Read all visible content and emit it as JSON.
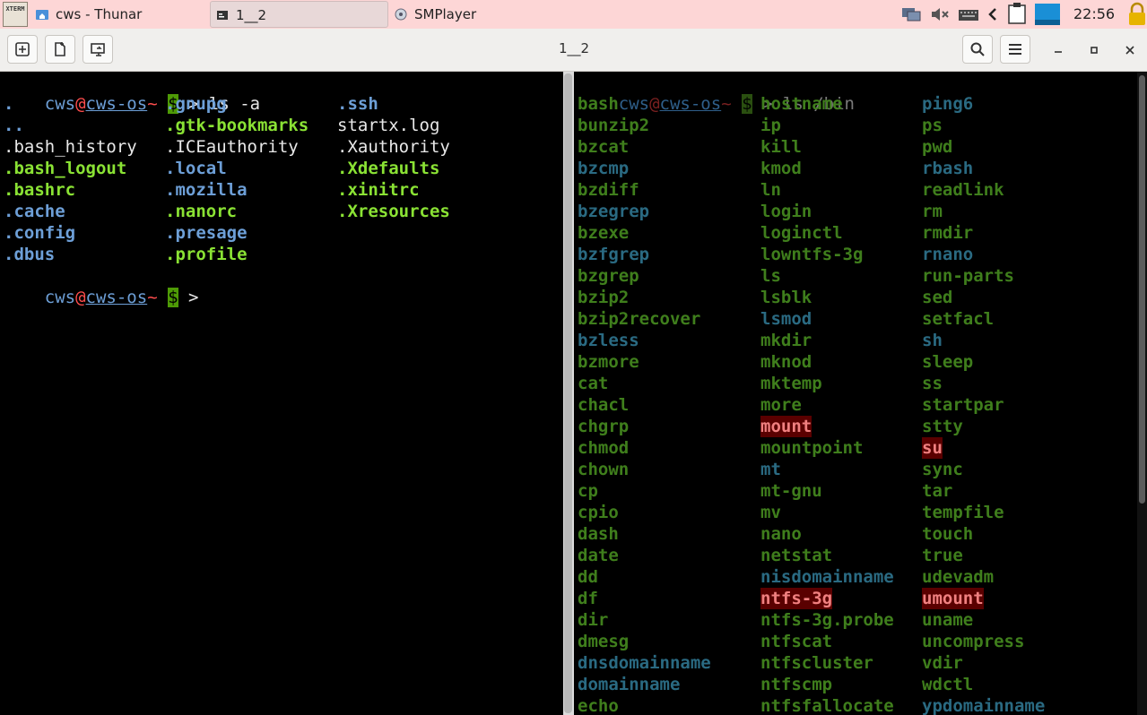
{
  "taskbar": {
    "menu_label": "XTERM",
    "tasks": [
      {
        "label": "cws - Thunar",
        "icon": "folder-home-icon"
      },
      {
        "label": "1__2",
        "icon": "terminal-icon"
      },
      {
        "label": "SMPlayer",
        "icon": "smplayer-icon"
      }
    ],
    "tray": [
      "network-icon",
      "volume-muted-icon",
      "keyboard-icon",
      "chevron-left-icon",
      "clipboard-icon",
      "workspace-icon",
      "lock-icon"
    ],
    "clock": "22:56"
  },
  "window": {
    "title": "1__2",
    "buttons": [
      "new-tab-icon",
      "split-icon",
      "detach-icon"
    ],
    "controls": [
      "search-icon",
      "menu-icon",
      "minimize-icon",
      "maximize-icon",
      "close-icon"
    ]
  },
  "left_terminal": {
    "prompt": {
      "user": "cws",
      "at": "@",
      "host": "cws-os",
      "tilde": "~",
      "dollar": "$",
      "arrow": " > "
    },
    "command": "ls -a",
    "columns": [
      [
        {
          "text": ".",
          "kind": "dir"
        },
        {
          "text": "..",
          "kind": "dir"
        },
        {
          "text": ".bash_history",
          "kind": "plain"
        },
        {
          "text": ".bash_logout",
          "kind": "exec"
        },
        {
          "text": ".bashrc",
          "kind": "exec"
        },
        {
          "text": ".cache",
          "kind": "dir"
        },
        {
          "text": ".config",
          "kind": "dir"
        },
        {
          "text": ".dbus",
          "kind": "dir"
        }
      ],
      [
        {
          "text": ".gnupg",
          "kind": "dir"
        },
        {
          "text": ".gtk-bookmarks",
          "kind": "exec"
        },
        {
          "text": ".ICEauthority",
          "kind": "plain"
        },
        {
          "text": ".local",
          "kind": "dir"
        },
        {
          "text": ".mozilla",
          "kind": "dir"
        },
        {
          "text": ".nanorc",
          "kind": "exec"
        },
        {
          "text": ".presage",
          "kind": "dir"
        },
        {
          "text": ".profile",
          "kind": "exec"
        }
      ],
      [
        {
          "text": ".ssh",
          "kind": "dir"
        },
        {
          "text": "startx.log",
          "kind": "plain"
        },
        {
          "text": ".Xauthority",
          "kind": "plain"
        },
        {
          "text": ".Xdefaults",
          "kind": "exec"
        },
        {
          "text": ".xinitrc",
          "kind": "exec"
        },
        {
          "text": ".Xresources",
          "kind": "exec"
        }
      ]
    ]
  },
  "right_terminal": {
    "prompt": {
      "user": "cws",
      "at": "@",
      "host": "cws-os",
      "tilde": "~",
      "dollar": "$",
      "arrow": " > "
    },
    "command": "ls /bin",
    "columns": [
      [
        {
          "text": "bash",
          "kind": "g"
        },
        {
          "text": "bunzip2",
          "kind": "g"
        },
        {
          "text": "bzcat",
          "kind": "g"
        },
        {
          "text": "bzcmp",
          "kind": "t"
        },
        {
          "text": "bzdiff",
          "kind": "g"
        },
        {
          "text": "bzegrep",
          "kind": "t"
        },
        {
          "text": "bzexe",
          "kind": "g"
        },
        {
          "text": "bzfgrep",
          "kind": "t"
        },
        {
          "text": "bzgrep",
          "kind": "g"
        },
        {
          "text": "bzip2",
          "kind": "g"
        },
        {
          "text": "bzip2recover",
          "kind": "g"
        },
        {
          "text": "bzless",
          "kind": "t"
        },
        {
          "text": "bzmore",
          "kind": "g"
        },
        {
          "text": "cat",
          "kind": "g"
        },
        {
          "text": "chacl",
          "kind": "g"
        },
        {
          "text": "chgrp",
          "kind": "g"
        },
        {
          "text": "chmod",
          "kind": "g"
        },
        {
          "text": "chown",
          "kind": "g"
        },
        {
          "text": "cp",
          "kind": "g"
        },
        {
          "text": "cpio",
          "kind": "g"
        },
        {
          "text": "dash",
          "kind": "g"
        },
        {
          "text": "date",
          "kind": "g"
        },
        {
          "text": "dd",
          "kind": "g"
        },
        {
          "text": "df",
          "kind": "g"
        },
        {
          "text": "dir",
          "kind": "g"
        },
        {
          "text": "dmesg",
          "kind": "g"
        },
        {
          "text": "dnsdomainname",
          "kind": "t"
        },
        {
          "text": "domainname",
          "kind": "t"
        },
        {
          "text": "echo",
          "kind": "g"
        }
      ],
      [
        {
          "text": "hostname",
          "kind": "g"
        },
        {
          "text": "ip",
          "kind": "g"
        },
        {
          "text": "kill",
          "kind": "g"
        },
        {
          "text": "kmod",
          "kind": "g"
        },
        {
          "text": "ln",
          "kind": "g"
        },
        {
          "text": "login",
          "kind": "g"
        },
        {
          "text": "loginctl",
          "kind": "g"
        },
        {
          "text": "lowntfs-3g",
          "kind": "g"
        },
        {
          "text": "ls",
          "kind": "g"
        },
        {
          "text": "lsblk",
          "kind": "g"
        },
        {
          "text": "lsmod",
          "kind": "t"
        },
        {
          "text": "mkdir",
          "kind": "g"
        },
        {
          "text": "mknod",
          "kind": "g"
        },
        {
          "text": "mktemp",
          "kind": "g"
        },
        {
          "text": "more",
          "kind": "g"
        },
        {
          "text": "mount",
          "kind": "red"
        },
        {
          "text": "mountpoint",
          "kind": "g"
        },
        {
          "text": "mt",
          "kind": "t"
        },
        {
          "text": "mt-gnu",
          "kind": "g"
        },
        {
          "text": "mv",
          "kind": "g"
        },
        {
          "text": "nano",
          "kind": "g"
        },
        {
          "text": "netstat",
          "kind": "g"
        },
        {
          "text": "nisdomainname",
          "kind": "t"
        },
        {
          "text": "ntfs-3g",
          "kind": "red"
        },
        {
          "text": "ntfs-3g.probe",
          "kind": "g"
        },
        {
          "text": "ntfscat",
          "kind": "g"
        },
        {
          "text": "ntfscluster",
          "kind": "g"
        },
        {
          "text": "ntfscmp",
          "kind": "g"
        },
        {
          "text": "ntfsfallocate",
          "kind": "g"
        }
      ],
      [
        {
          "text": "ping6",
          "kind": "t"
        },
        {
          "text": "ps",
          "kind": "g"
        },
        {
          "text": "pwd",
          "kind": "g"
        },
        {
          "text": "rbash",
          "kind": "t"
        },
        {
          "text": "readlink",
          "kind": "g"
        },
        {
          "text": "rm",
          "kind": "g"
        },
        {
          "text": "rmdir",
          "kind": "g"
        },
        {
          "text": "rnano",
          "kind": "t"
        },
        {
          "text": "run-parts",
          "kind": "g"
        },
        {
          "text": "sed",
          "kind": "g"
        },
        {
          "text": "setfacl",
          "kind": "g"
        },
        {
          "text": "sh",
          "kind": "t"
        },
        {
          "text": "sleep",
          "kind": "g"
        },
        {
          "text": "ss",
          "kind": "g"
        },
        {
          "text": "startpar",
          "kind": "g"
        },
        {
          "text": "stty",
          "kind": "g"
        },
        {
          "text": "su",
          "kind": "red"
        },
        {
          "text": "sync",
          "kind": "g"
        },
        {
          "text": "tar",
          "kind": "g"
        },
        {
          "text": "tempfile",
          "kind": "g"
        },
        {
          "text": "touch",
          "kind": "g"
        },
        {
          "text": "true",
          "kind": "g"
        },
        {
          "text": "udevadm",
          "kind": "g"
        },
        {
          "text": "umount",
          "kind": "red"
        },
        {
          "text": "uname",
          "kind": "g"
        },
        {
          "text": "uncompress",
          "kind": "g"
        },
        {
          "text": "vdir",
          "kind": "g"
        },
        {
          "text": "wdctl",
          "kind": "g"
        },
        {
          "text": "ypdomainname",
          "kind": "t"
        }
      ]
    ]
  }
}
